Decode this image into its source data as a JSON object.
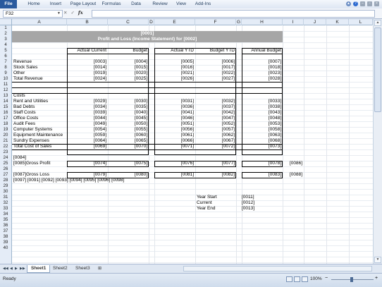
{
  "ribbon": {
    "tabs": [
      "File",
      "Home",
      "Insert",
      "Page Layout",
      "Formulas",
      "Data",
      "Review",
      "View",
      "Add-Ins"
    ],
    "right_icons": [
      "help-icon",
      "minimize-icon",
      "restore-icon",
      "close-icon"
    ]
  },
  "formula_bar": {
    "name_box": "F32",
    "fx_label": "fx",
    "formula": ""
  },
  "columns": [
    "A",
    "B",
    "C",
    "D",
    "E",
    "F",
    "G",
    "H",
    "I",
    "J",
    "K",
    "L"
  ],
  "rows": [
    "1",
    "2",
    "3",
    "4",
    "5",
    "6",
    "7",
    "8",
    "9",
    "10",
    "11",
    "12",
    "13",
    "14",
    "15",
    "16",
    "17",
    "18",
    "19",
    "20",
    "21",
    "22",
    "23",
    "24",
    "25",
    "26",
    "27",
    "28",
    "29",
    "30",
    "31",
    "32",
    "33",
    "34",
    "35",
    "36",
    "37",
    "38",
    "39",
    "40"
  ],
  "sheet": {
    "title1": "[0001]",
    "title2": "Profit and Loss (Income Statement) for [0002]",
    "headers": {
      "actual_current": "Actual Current",
      "budget": "Budget",
      "actual_ytd": "Actual YTD",
      "budget_ytd": "Budget YTD",
      "annual_budget": "Annual Budget"
    },
    "revenue_rows": [
      {
        "label": "Revenue",
        "ac": "[0003]",
        "b": "[0004]",
        "ay": "[0005]",
        "by": "[0006]",
        "ab": "[0007]"
      },
      {
        "label": "Stock Sales",
        "ac": "[0014]",
        "b": "[0015]",
        "ay": "[0016]",
        "by": "[0017]",
        "ab": "[0018]"
      },
      {
        "label": "Other",
        "ac": "[0019]",
        "b": "[0020]",
        "ay": "[0021]",
        "by": "[0022]",
        "ab": "[0023]"
      },
      {
        "label": "Total Revenue",
        "ac": "[0024]",
        "b": "[0025]",
        "ay": "[0026]",
        "by": "[0027]",
        "ab": "[0028]"
      }
    ],
    "costs_label": "Costs",
    "cost_rows": [
      {
        "label": "Rent and Utilities",
        "ac": "[0029]",
        "b": "[0030]",
        "ay": "[0031]",
        "by": "[0032]",
        "ab": "[0033]"
      },
      {
        "label": "Bad Debts",
        "ac": "[0034]",
        "b": "[0035]",
        "ay": "[0036]",
        "by": "[0037]",
        "ab": "[0038]"
      },
      {
        "label": "Staff Costs",
        "ac": "[0039]",
        "b": "[0040]",
        "ay": "[0041]",
        "by": "[0042]",
        "ab": "[0043]"
      },
      {
        "label": "Office Costs",
        "ac": "[0044]",
        "b": "[0045]",
        "ay": "[0046]",
        "by": "[0047]",
        "ab": "[0048]"
      },
      {
        "label": "Audit Fees",
        "ac": "[0049]",
        "b": "[0050]",
        "ay": "[0051]",
        "by": "[0052]",
        "ab": "[0053]"
      },
      {
        "label": "Computer Systems",
        "ac": "[0054]",
        "b": "[0055]",
        "ay": "[0056]",
        "by": "[0057]",
        "ab": "[0058]"
      },
      {
        "label": "Equipment Maintenance",
        "ac": "[0059]",
        "b": "[0060]",
        "ay": "[0061]",
        "by": "[0062]",
        "ab": "[0063]"
      },
      {
        "label": "Sundry Expenses",
        "ac": "[0064]",
        "b": "[0065]",
        "ay": "[0066]",
        "by": "[0067]",
        "ab": "[0068]"
      },
      {
        "label": "Total Cost of Sales",
        "ac": "[0069]",
        "b": "[0070]",
        "ay": "[0071]",
        "by": "[0072]",
        "ab": "[0073]"
      }
    ],
    "row22": "[0084]",
    "gross_profit": {
      "label": "[0085]Gross Profit",
      "ac": "[0074]",
      "b": "[0075]",
      "ay": "[0076]",
      "by": "[0077]",
      "ab": "[0078]",
      "extra": "[0086]"
    },
    "gross_loss": {
      "label": "[0087]Gross Loss",
      "ac": "[0079]",
      "b": "[0080]",
      "ay": "[0081]",
      "by": "[0082]",
      "ab": "[0083]",
      "extra": "[0088]"
    },
    "row26": "[0097] [0091] [0092] [0093] [0094] [0095] [0096] [0098]",
    "dates": [
      {
        "label": "Year Start",
        "value": "[0011]"
      },
      {
        "label": "Current",
        "value": "[0012]"
      },
      {
        "label": "Year End",
        "value": "[0013]"
      }
    ]
  },
  "sheet_tabs": [
    "Sheet1",
    "Sheet2",
    "Sheet3"
  ],
  "status": {
    "ready": "Ready",
    "zoom": "100%"
  }
}
